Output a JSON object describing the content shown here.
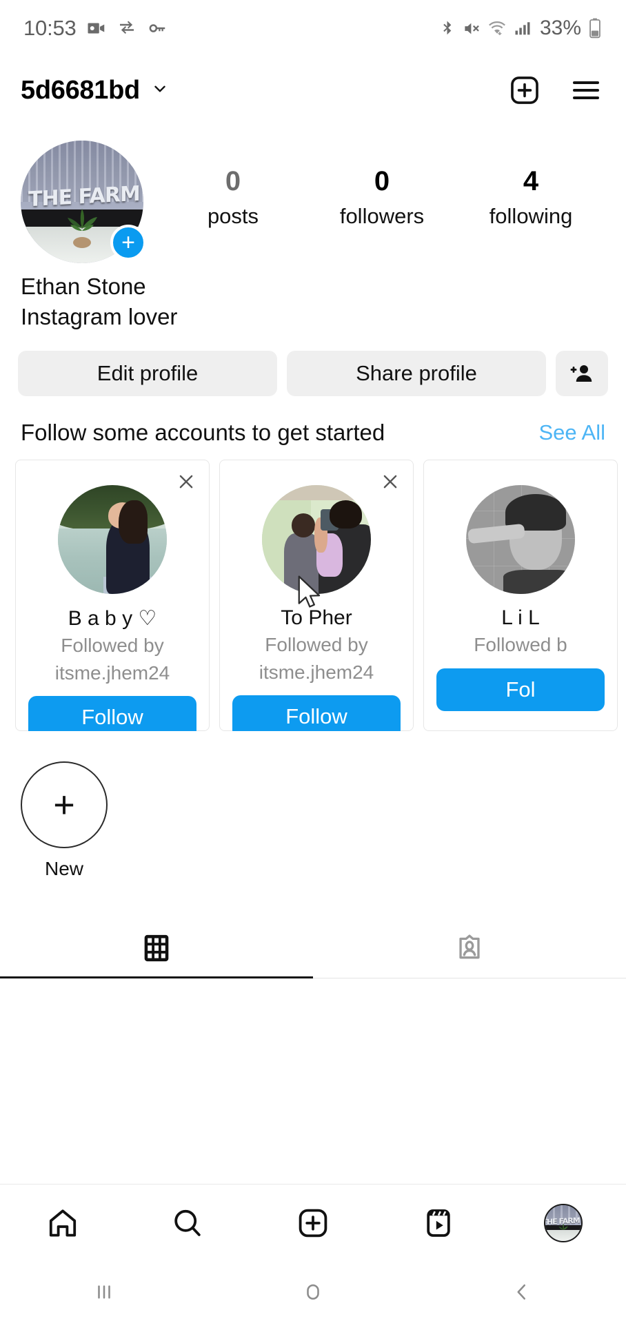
{
  "status_bar": {
    "time": "10:53",
    "battery_percent": "33%",
    "left_icons": [
      "video-recorder-icon",
      "data-saver-icon",
      "vpn-key-icon"
    ],
    "right_icons": [
      "bluetooth-icon",
      "mute-icon",
      "wifi-icon",
      "signal-icon",
      "battery-icon"
    ]
  },
  "header": {
    "username": "5d6681bd",
    "dropdown_icon": "chevron-down-icon",
    "create_icon": "plus-box-icon",
    "menu_icon": "hamburger-menu-icon"
  },
  "profile": {
    "avatar_label": "THE FARM",
    "add_story_icon": "plus-icon",
    "stats": [
      {
        "value": "0",
        "label": "posts",
        "muted": true
      },
      {
        "value": "0",
        "label": "followers",
        "muted": false
      },
      {
        "value": "4",
        "label": "following",
        "muted": false
      }
    ],
    "name": "Ethan Stone",
    "bio": "Instagram lover"
  },
  "actions": {
    "edit_profile": "Edit profile",
    "share_profile": "Share profile",
    "discover_people_icon": "add-person-icon"
  },
  "suggestions": {
    "title": "Follow some accounts to get started",
    "see_all": "See All",
    "close_icon": "close-icon",
    "cards": [
      {
        "name": "B a b y ♡",
        "subtitle_line1": "Followed by",
        "subtitle_line2": "itsme.jhem24",
        "follow_label": "Follow",
        "avatar": "woman-by-lake-photo"
      },
      {
        "name": "To Pher",
        "subtitle_line1": "Followed by",
        "subtitle_line2": "itsme.jhem24",
        "follow_label": "Follow",
        "avatar": "mirror-selfie-photo"
      },
      {
        "name": "L i L",
        "subtitle_line1": "Followed b",
        "subtitle_line2": "",
        "follow_label": "Fol",
        "avatar": "bw-portrait-photo"
      }
    ]
  },
  "highlights": [
    {
      "icon": "plus-icon",
      "label": "New"
    }
  ],
  "tabs": [
    {
      "icon": "grid-icon",
      "active": true
    },
    {
      "icon": "tagged-person-icon",
      "active": false
    }
  ],
  "bottom_nav": [
    {
      "icon": "home-icon",
      "active": true
    },
    {
      "icon": "search-icon",
      "active": false
    },
    {
      "icon": "plus-box-icon",
      "active": false
    },
    {
      "icon": "reels-icon",
      "active": false
    },
    {
      "icon": "profile-avatar-icon",
      "active": true
    }
  ],
  "android_nav": [
    {
      "icon": "recents-icon"
    },
    {
      "icon": "home-circle-icon"
    },
    {
      "icon": "back-icon"
    }
  ],
  "colors": {
    "accent_blue": "#0d9bf0",
    "link_blue": "#4db5f5",
    "button_grey": "#efefef",
    "muted_text": "#8e8e8e"
  },
  "cursor": {
    "visible": true
  }
}
